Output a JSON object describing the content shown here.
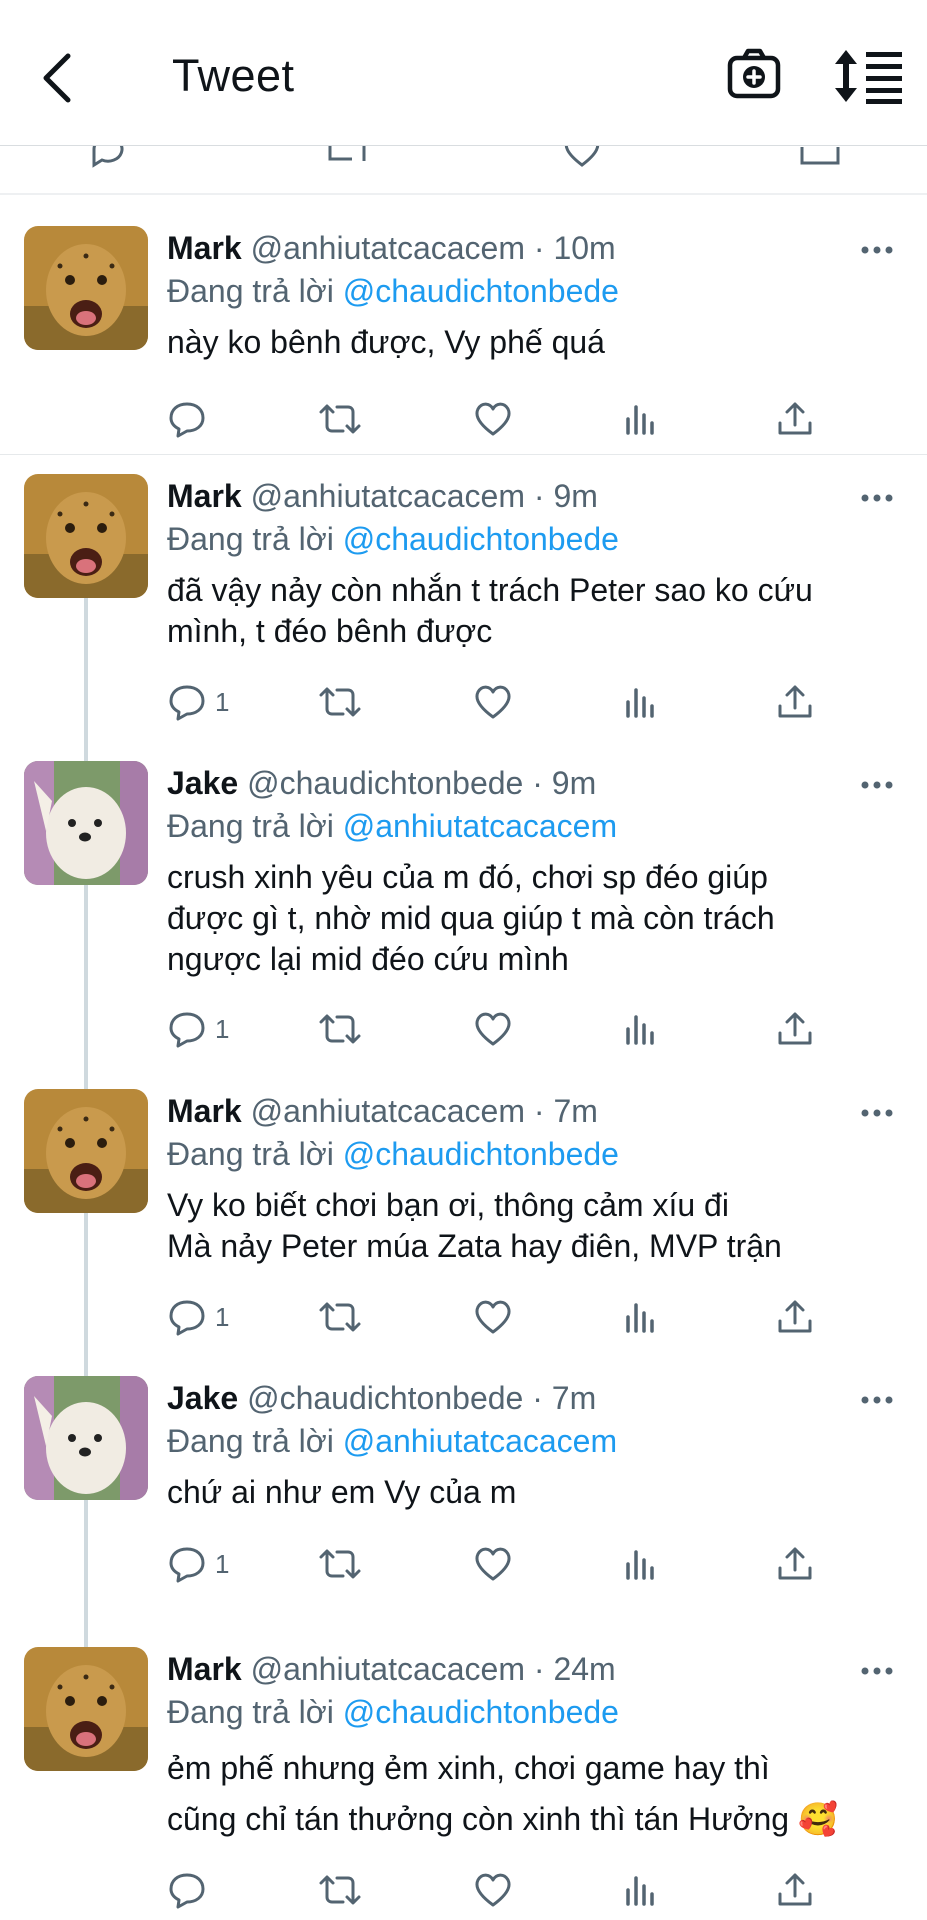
{
  "header": {
    "title": "Tweet"
  },
  "icons": {
    "back": "chevron-left-icon",
    "camera": "camera-plus-icon",
    "sort": "sort-icon",
    "more": "more-horizontal-icon",
    "reply": "reply-icon",
    "retweet": "retweet-icon",
    "like": "heart-icon",
    "views": "views-icon",
    "share": "share-icon"
  },
  "colors": {
    "mention": "#1d9bf0",
    "meta": "#536471",
    "text": "#0f1419"
  },
  "replies": [
    {
      "name": "Mark",
      "handle": "@anhiutatcacacem",
      "sep": " · ",
      "time": "10m",
      "replying_label": "Đang trả lời",
      "replying_to": "@chaudichtonbede",
      "text": "này ko bênh được, Vy phế quá",
      "reply_count": ""
    },
    {
      "name": "Mark",
      "handle": "@anhiutatcacacem",
      "sep": " · ",
      "time": "9m",
      "replying_label": "Đang trả lời",
      "replying_to": "@chaudichtonbede",
      "text": "đã vậy nảy còn nhắn t trách Peter sao ko cứu\nmình, t đéo bênh được",
      "reply_count": "1"
    },
    {
      "name": "Jake",
      "handle": "@chaudichtonbede",
      "sep": " · ",
      "time": "9m",
      "replying_label": "Đang trả lời",
      "replying_to": "@anhiutatcacacem",
      "text": "crush xinh yêu của m đó, chơi sp đéo giúp\nđược gì t, nhờ mid qua giúp t mà còn trách\nngược lại mid đéo cứu mình",
      "reply_count": "1"
    },
    {
      "name": "Mark",
      "handle": "@anhiutatcacacem",
      "sep": " · ",
      "time": "7m",
      "replying_label": "Đang trả lời",
      "replying_to": "@chaudichtonbede",
      "text": "Vy ko biết chơi bạn ơi, thông cảm xíu đi\nMà nảy Peter múa Zata hay điên, MVP trận",
      "reply_count": "1"
    },
    {
      "name": "Jake",
      "handle": "@chaudichtonbede",
      "sep": " · ",
      "time": "7m",
      "replying_label": "Đang trả lời",
      "replying_to": "@anhiutatcacacem",
      "text": "chứ ai như em Vy của m",
      "reply_count": "1"
    },
    {
      "name": "Mark",
      "handle": "@anhiutatcacacem",
      "sep": " · ",
      "time": "24m",
      "replying_label": "Đang trả lời",
      "replying_to": "@chaudichtonbede",
      "text": "ẻm phế nhưng ẻm xinh, chơi game hay thì\ncũng chỉ tán thưởng còn xinh thì tán Hưởng 🥰",
      "reply_count": ""
    }
  ]
}
